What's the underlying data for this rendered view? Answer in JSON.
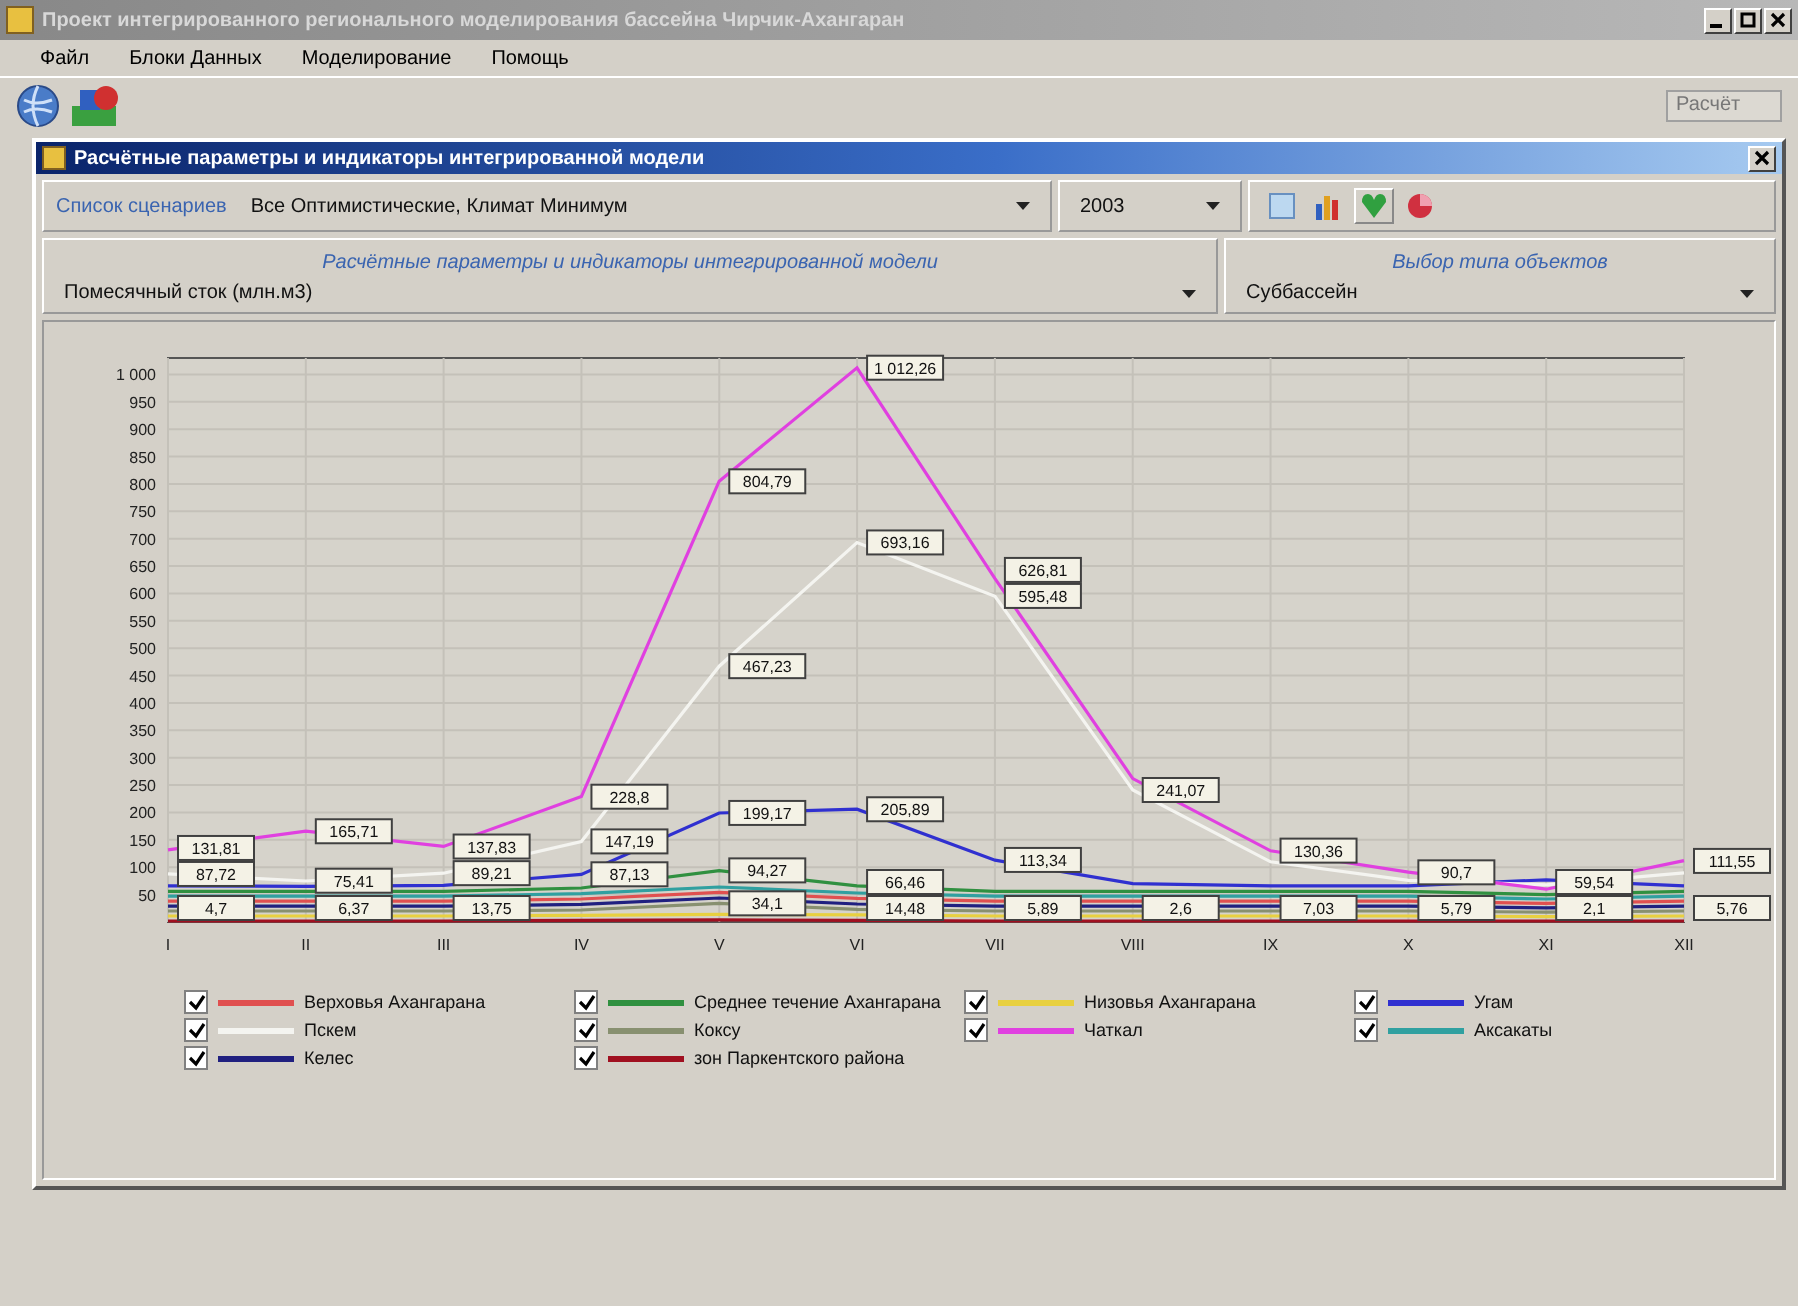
{
  "window": {
    "title": "Проект интегрированного регионального моделирования бассейна Чирчик-Ахангаран"
  },
  "menu": [
    {
      "label": "Файл"
    },
    {
      "label": "Блоки Данных"
    },
    {
      "label": "Моделирование"
    },
    {
      "label": "Помощь"
    }
  ],
  "toolbar": {
    "field_value": "Расчёт"
  },
  "child_window": {
    "title": "Расчётные параметры и индикаторы интегрированной модели"
  },
  "scenario": {
    "label": "Список сценариев",
    "value": "Все Оптимистические, Климат Минимум",
    "year": "2003"
  },
  "parameters": {
    "heading": "Расчётные параметры и индикаторы интегрированной модели",
    "value": "Помесячный сток (млн.м3)"
  },
  "object_type": {
    "heading": "Выбор типа объектов",
    "value": "Суббассейн"
  },
  "chart": {
    "chart_data": {
      "type": "line",
      "grid": true,
      "categories": [
        "I",
        "II",
        "III",
        "IV",
        "V",
        "VI",
        "VII",
        "VIII",
        "IX",
        "X",
        "XI",
        "XII"
      ],
      "ylim": [
        0,
        1030
      ],
      "yticks": [
        50,
        100,
        150,
        200,
        250,
        300,
        350,
        400,
        450,
        500,
        550,
        600,
        650,
        700,
        750,
        800,
        850,
        900,
        950,
        {
          "value": 1000,
          "label": "1 000"
        }
      ],
      "series": [
        {
          "name": "Верховья Ахангарана",
          "color": "#e05050",
          "values": [
            38,
            38,
            38,
            42,
            54,
            43,
            38,
            38,
            38,
            38,
            34,
            38
          ]
        },
        {
          "name": "Среднее течение Ахангарана",
          "color": "#309040",
          "values": [
            56,
            56,
            56,
            62,
            94,
            66,
            56,
            56,
            56,
            56,
            50,
            56
          ]
        },
        {
          "name": "Низовья Ахангарана",
          "color": "#e8d040",
          "values": [
            11,
            11,
            11,
            12,
            14,
            13,
            11,
            11,
            11,
            11,
            10,
            11
          ]
        },
        {
          "name": "Угам",
          "color": "#3030d0",
          "values": [
            66,
            65,
            67,
            87,
            199,
            206,
            113,
            70,
            66,
            66,
            77,
            66
          ]
        },
        {
          "name": "Пскем",
          "color": "#f4f4f0",
          "values": [
            88,
            75,
            89,
            147,
            467,
            693,
            595,
            241,
            110,
            76,
            68,
            90
          ]
        },
        {
          "name": "Коксу",
          "color": "#889070",
          "values": [
            20,
            20,
            20,
            22,
            34,
            23,
            20,
            20,
            20,
            20,
            18,
            20
          ]
        },
        {
          "name": "Чаткал",
          "color": "#e040e0",
          "values": [
            132,
            166,
            138,
            229,
            805,
            1012,
            627,
            262,
            130,
            91,
            60,
            112
          ]
        },
        {
          "name": "Аксакаты",
          "color": "#30a0a0",
          "values": [
            47,
            47,
            47,
            52,
            64,
            53,
            47,
            47,
            47,
            47,
            42,
            47
          ]
        },
        {
          "name": "Келес",
          "color": "#202080",
          "values": [
            29,
            29,
            29,
            32,
            44,
            33,
            29,
            29,
            29,
            29,
            26,
            29
          ]
        },
        {
          "name": "зон Паркентского района",
          "color": "#a01020",
          "values": [
            2,
            2,
            2,
            3,
            4,
            3,
            2,
            2,
            2,
            2,
            2,
            2
          ]
        }
      ],
      "annotations": [
        {
          "x": "I",
          "y": 131.81,
          "text": "131,81"
        },
        {
          "x": "I",
          "y": 87.72,
          "text": "87,72"
        },
        {
          "x": "I",
          "y": 4.7,
          "text": "4,7"
        },
        {
          "x": "II",
          "y": 165.71,
          "text": "165,71"
        },
        {
          "x": "II",
          "y": 75.41,
          "text": "75,41"
        },
        {
          "x": "II",
          "y": 6.37,
          "text": "6,37"
        },
        {
          "x": "III",
          "y": 137.83,
          "text": "137,83"
        },
        {
          "x": "III",
          "y": 89.21,
          "text": "89,21"
        },
        {
          "x": "III",
          "y": 13.75,
          "text": "13,75"
        },
        {
          "x": "IV",
          "y": 228.8,
          "text": "228,8"
        },
        {
          "x": "IV",
          "y": 147.19,
          "text": "147,19"
        },
        {
          "x": "IV",
          "y": 87.13,
          "text": "87,13"
        },
        {
          "x": "V",
          "y": 804.79,
          "text": "804,79"
        },
        {
          "x": "V",
          "y": 467.23,
          "text": "467,23"
        },
        {
          "x": "V",
          "y": 199.17,
          "text": "199,17"
        },
        {
          "x": "V",
          "y": 94.27,
          "text": "94,27"
        },
        {
          "x": "V",
          "y": 34.1,
          "text": "34,1"
        },
        {
          "x": "VI",
          "y": 1012.26,
          "text": "1 012,26"
        },
        {
          "x": "VI",
          "y": 693.16,
          "text": "693,16"
        },
        {
          "x": "VI",
          "y": 205.89,
          "text": "205,89"
        },
        {
          "x": "VI",
          "y": 66.46,
          "text": "66,46"
        },
        {
          "x": "VI",
          "y": 14.48,
          "text": "14,48"
        },
        {
          "x": "VII",
          "y": 626.81,
          "text": "626,81"
        },
        {
          "x": "VII",
          "y": 595.48,
          "text": "595,48"
        },
        {
          "x": "VII",
          "y": 113.34,
          "text": "113,34"
        },
        {
          "x": "VII",
          "y": 5.89,
          "text": "5,89"
        },
        {
          "x": "VIII",
          "y": 241.07,
          "text": "241,07"
        },
        {
          "x": "VIII",
          "y": 2.6,
          "text": "2,6"
        },
        {
          "x": "IX",
          "y": 130.36,
          "text": "130,36"
        },
        {
          "x": "IX",
          "y": 7.03,
          "text": "7,03"
        },
        {
          "x": "X",
          "y": 90.7,
          "text": "90,7"
        },
        {
          "x": "X",
          "y": 5.79,
          "text": "5,79"
        },
        {
          "x": "XI",
          "y": 59.54,
          "text": "59,54"
        },
        {
          "x": "XI",
          "y": 2.1,
          "text": "2,1"
        },
        {
          "x": "XII",
          "y": 111.55,
          "text": "111,55"
        },
        {
          "x": "XII",
          "y": 5.76,
          "text": "5,76"
        }
      ]
    },
    "legend": [
      {
        "checked": true
      },
      {
        "checked": true
      },
      {
        "checked": true
      },
      {
        "checked": true
      },
      {
        "checked": true
      },
      {
        "checked": true
      },
      {
        "checked": true
      },
      {
        "checked": true
      },
      {
        "checked": true
      },
      {
        "checked": true
      }
    ]
  }
}
